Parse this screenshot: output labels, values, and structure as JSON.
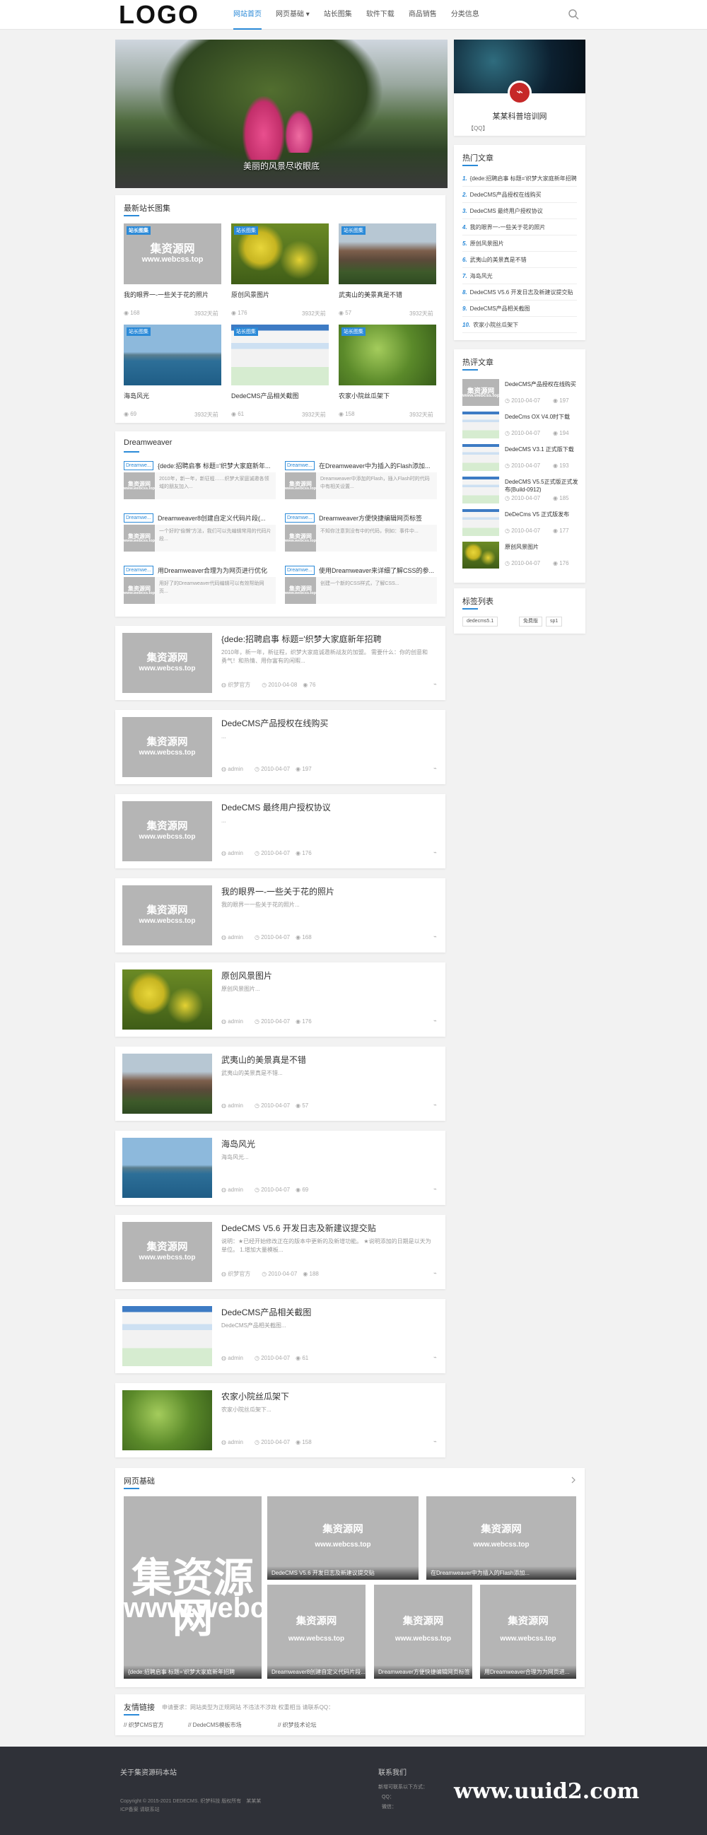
{
  "header": {
    "logo": "LOGO",
    "nav": [
      "网站首页",
      "网页基础",
      "站长图集",
      "软件下载",
      "商品销售",
      "分类信息"
    ],
    "active": 0
  },
  "banner": {
    "caption": "美丽的风景尽收眼底"
  },
  "profile": {
    "name": "某某科普培训网",
    "qq": "【QQ】"
  },
  "hotArticles": {
    "title": "热门文章",
    "items": [
      "{dede:招聘启事 标题='织梦大家庭新年招聘",
      "DedeCMS产品授权在线购买",
      "DedeCMS 最终用户授权协议",
      "我的眼界一-一些关于花的照片",
      "原创风景图片",
      "武夷山的美景真是不错",
      "海岛风光",
      "DedeCMS V5.6 开发日志及新建议提交贴",
      "DedeCMS产品相关截图",
      "农家小院丝瓜架下"
    ]
  },
  "reviewArticles": {
    "title": "热评文章",
    "items": [
      {
        "t": "DedeCMS产品授权在线购买",
        "d": "2010-04-07",
        "v": "197"
      },
      {
        "t": "DedeCms OX V4.0时下载",
        "d": "2010-04-07",
        "v": "194"
      },
      {
        "t": "DedeCMS V3.1 正式版下载",
        "d": "2010-04-07",
        "v": "193"
      },
      {
        "t": "DedeCMS V5.5正式版正式发布(Build-0912)",
        "d": "2010-04-07",
        "v": "185"
      },
      {
        "t": "DeDeCms V5 正式版发布",
        "d": "2010-04-07",
        "v": "177"
      },
      {
        "t": "原创风景图片",
        "d": "2010-04-07",
        "v": "176"
      }
    ]
  },
  "tags": {
    "title": "标签列表",
    "items": [
      "dedecms5.1",
      "免费版",
      "sp1"
    ]
  },
  "gallery": {
    "title": "最新站长图集",
    "items": [
      {
        "t": "我的眼界一-一些关于花的照片",
        "v": "168",
        "s": "3932天前"
      },
      {
        "t": "原创风景图片",
        "v": "176",
        "s": "3932天前"
      },
      {
        "t": "武夷山的美景真是不错",
        "v": "57",
        "s": "3932天前"
      },
      {
        "t": "海岛风光",
        "v": "69",
        "s": "3932天前"
      },
      {
        "t": "DedeCMS产品相关截图",
        "v": "61",
        "s": "3932天前"
      },
      {
        "t": "农家小院丝瓜架下",
        "v": "158",
        "s": "3932天前"
      }
    ],
    "badge": "站长图集"
  },
  "dw": {
    "title": "Dreamweaver",
    "items": [
      {
        "t": "{dede:招聘启事 标题='织梦大家庭新年...",
        "d": "2010年，新一年，新征程……织梦大家庭诚邀各领域的朋友加入..."
      },
      {
        "t": "在Dreamweaver中为插入的Flash添加...",
        "d": "Dreamweaver中添加的Flash，插入Flash时的代码中有相关设置..."
      },
      {
        "t": "Dreamweaver8创建自定义代码片段(...",
        "d": "一个好的“偷懒”方法，我们可以先编辑常用的代码片段..."
      },
      {
        "t": "Dreamweaver方便快捷编辑网页标签",
        "d": "不知你注意到没有中的代码，例如：事件中..."
      },
      {
        "t": "用Dreamweaver合理为为网页进行优化",
        "d": "用好了的Dreamweaver代码编辑可以有效帮助网页..."
      },
      {
        "t": "使用Dreamweaver来详细了解CSS的参...",
        "d": "创建一个新的CSS样式，了解CSS..."
      }
    ],
    "badge": "Dreamwe..."
  },
  "posts": [
    {
      "t": "{dede:招聘启事 标题='织梦大家庭新年招聘",
      "d": "2010年，新一年，新征程，织梦大家庭诚邀新战友的加盟。 需要什么：你的创意和勇气！和热情、用你富有的闲暇...",
      "a": "织梦官方",
      "date": "2010-04-08",
      "v": "76",
      "img": "ph"
    },
    {
      "t": "DedeCMS产品授权在线购买",
      "d": "...",
      "a": "admin",
      "date": "2010-04-07",
      "v": "197",
      "img": "ph"
    },
    {
      "t": "DedeCMS 最终用户授权协议",
      "d": "...",
      "a": "admin",
      "date": "2010-04-07",
      "v": "176",
      "img": "ph"
    },
    {
      "t": "我的眼界一-一些关于花的照片",
      "d": "我的眼界一一些关于花的照片...",
      "a": "admin",
      "date": "2010-04-07",
      "v": "168",
      "img": "ph"
    },
    {
      "t": "原创风景图片",
      "d": "原创风景图片...",
      "a": "admin",
      "date": "2010-04-07",
      "v": "176",
      "img": "flower"
    },
    {
      "t": "武夷山的美景真是不错",
      "d": "武夷山的美景真是不错...",
      "a": "admin",
      "date": "2010-04-07",
      "v": "57",
      "img": "mountain"
    },
    {
      "t": "海岛风光",
      "d": "海岛风光...",
      "a": "admin",
      "date": "2010-04-07",
      "v": "69",
      "img": "sea"
    },
    {
      "t": "DedeCMS V5.6 开发日志及新建议提交贴",
      "d": "说明：★已经开始修改正在的版本中更新的及新增功能。 ★说明添加的日期是以天为单位。 1.增加大量模板...",
      "a": "织梦官方",
      "date": "2010-04-07",
      "v": "188",
      "img": "ph"
    },
    {
      "t": "DedeCMS产品相关截图",
      "d": "DedeCMS产品相关截图...",
      "a": "admin",
      "date": "2010-04-07",
      "v": "61",
      "img": "screen"
    },
    {
      "t": "农家小院丝瓜架下",
      "d": "农家小院丝瓜架下...",
      "a": "admin",
      "date": "2010-04-07",
      "v": "158",
      "img": "green"
    }
  ],
  "webBasics": {
    "title": "网页基础",
    "items": [
      "{dede:招聘启事 标题='织梦大家庭新年招聘",
      "DedeCMS V5.6 开发日志及新建议提交贴",
      "在Dreamweaver中为插入的Flash添加...",
      "Dreamweaver8创建自定义代码片段...",
      "Dreamweaver方便快捷编辑网页标签",
      "用Dreamweaver合理为为网页进..."
    ]
  },
  "links": {
    "title": "友情链接",
    "note": "申请要求：网站类型为正规网站 不违法不涉政 权重相当 请联系QQ：",
    "items": [
      "织梦CMS官方",
      "DedeCMS模板市场",
      "织梦技术论坛"
    ]
  },
  "footer": {
    "about": "关于集资源码本站",
    "copy": "Copyright © 2015-2021 DEDECMS. 织梦科技 版权所有　某某某",
    "icp": "ICP备案 请联系站",
    "contact": "联系我们",
    "contact_desc": "新增可联系以下方式：",
    "qq": "QQ：",
    "email": "微信："
  },
  "watermark": "www.uuid2.com",
  "placeholder": {
    "l1": "集资源网",
    "l2": "www.webcss.top"
  }
}
